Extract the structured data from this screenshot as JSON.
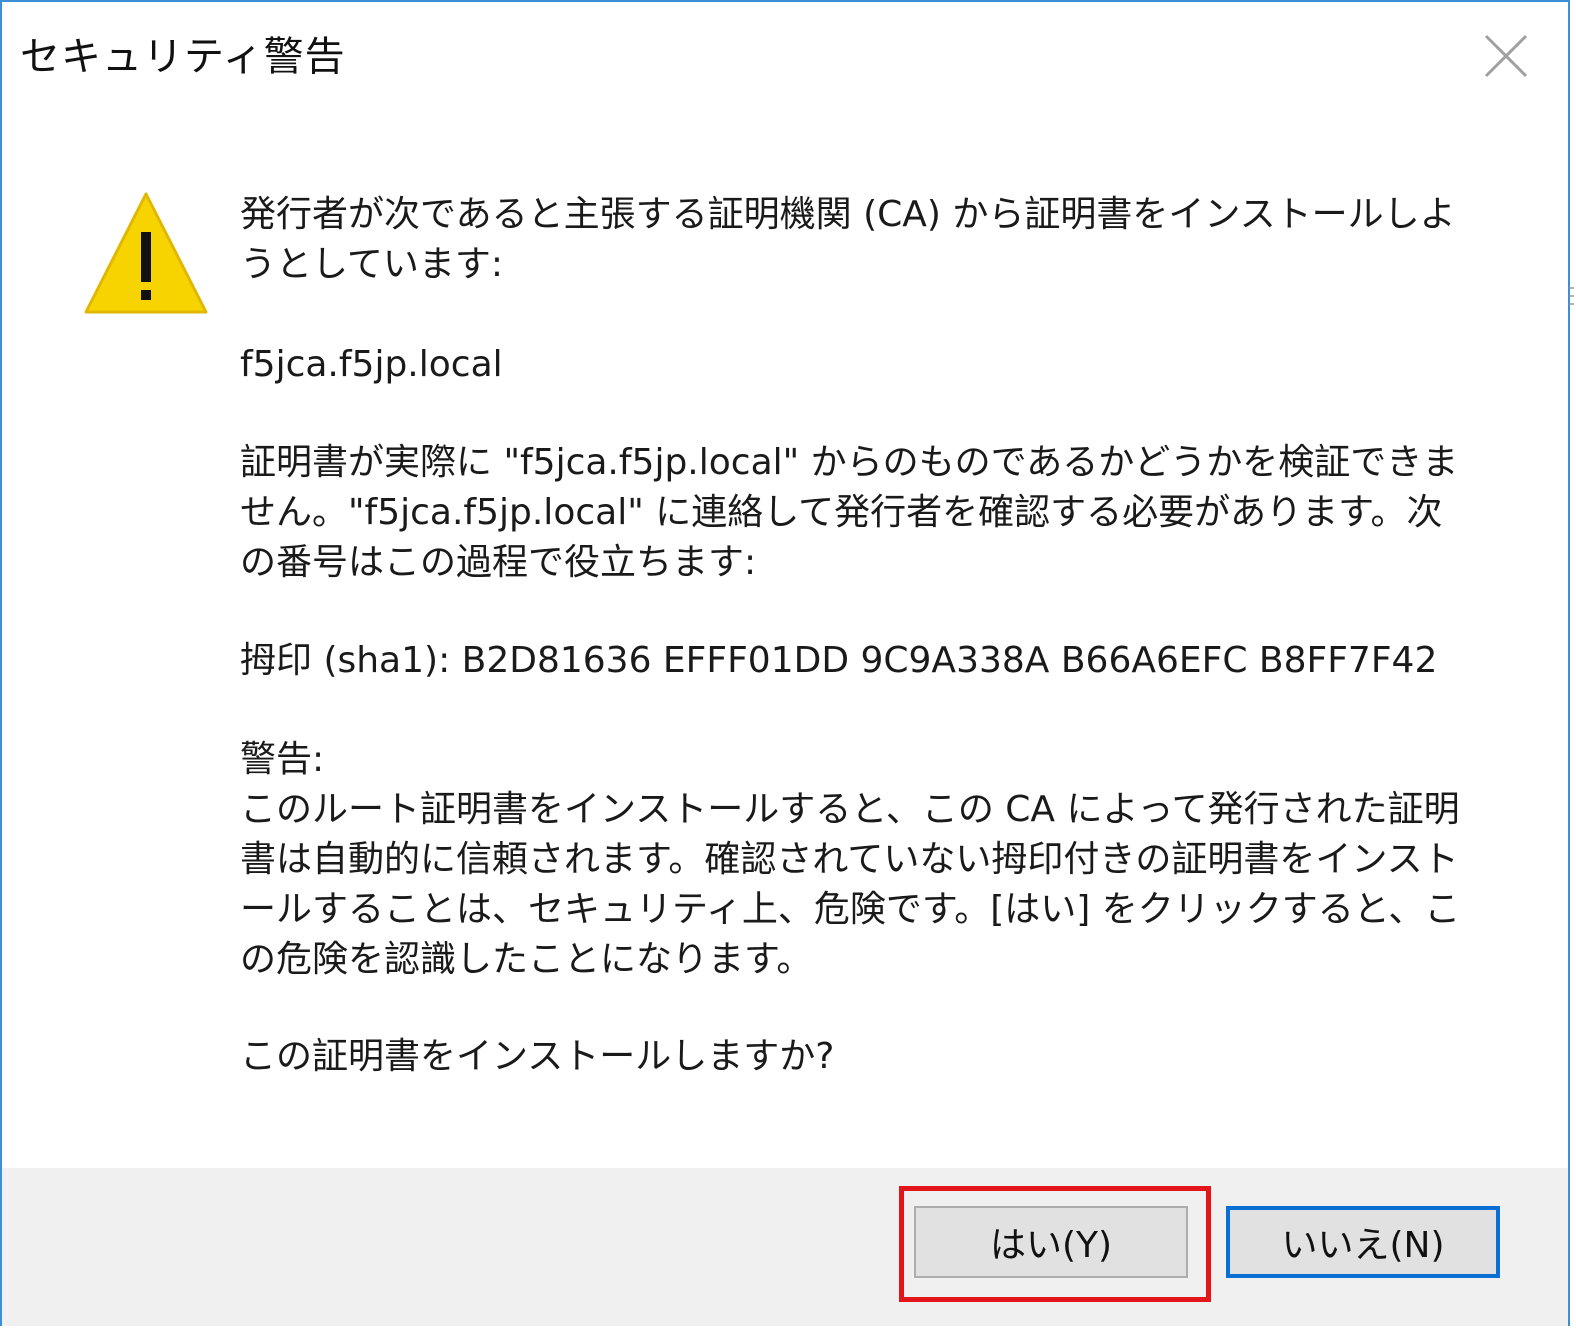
{
  "window": {
    "title": "セキュリティ警告",
    "close_icon": "close-icon"
  },
  "icon": {
    "name": "warning-triangle-icon",
    "fill_color": "#f7d300",
    "stroke_color": "#e0b800"
  },
  "message": {
    "ca_notice": "発行者が次であると主張する証明機関 (CA) から証明書をインストールしようとしています:",
    "issuer": "f5jca.f5jp.local",
    "verify_notice": "証明書が実際に \"f5jca.f5jp.local\" からのものであるかどうかを検証できません。\"f5jca.f5jp.local\" に連絡して発行者を確認する必要があります。次の番号はこの過程で役立ちます:",
    "thumbprint": "拇印 (sha1): B2D81636 EFFF01DD 9C9A338A B66A6EFC B8FF7F42",
    "warning_heading": "警告:",
    "warning_body": "このルート証明書をインストールすると、この CA によって発行された証明書は自動的に信頼されます。確認されていない拇印付きの証明書をインストールすることは、セキュリティ上、危険です。[はい] をクリックすると、この危険を認識したことになります。",
    "question": "この証明書をインストールしますか?"
  },
  "buttons": {
    "yes_label": "はい(Y)",
    "no_label": "いいえ(N)"
  },
  "colors": {
    "window_border": "#3c8fd6",
    "footer_bg": "#f0f0f0",
    "default_button_border": "#0a6fd4",
    "highlight_box": "#e3151b"
  }
}
